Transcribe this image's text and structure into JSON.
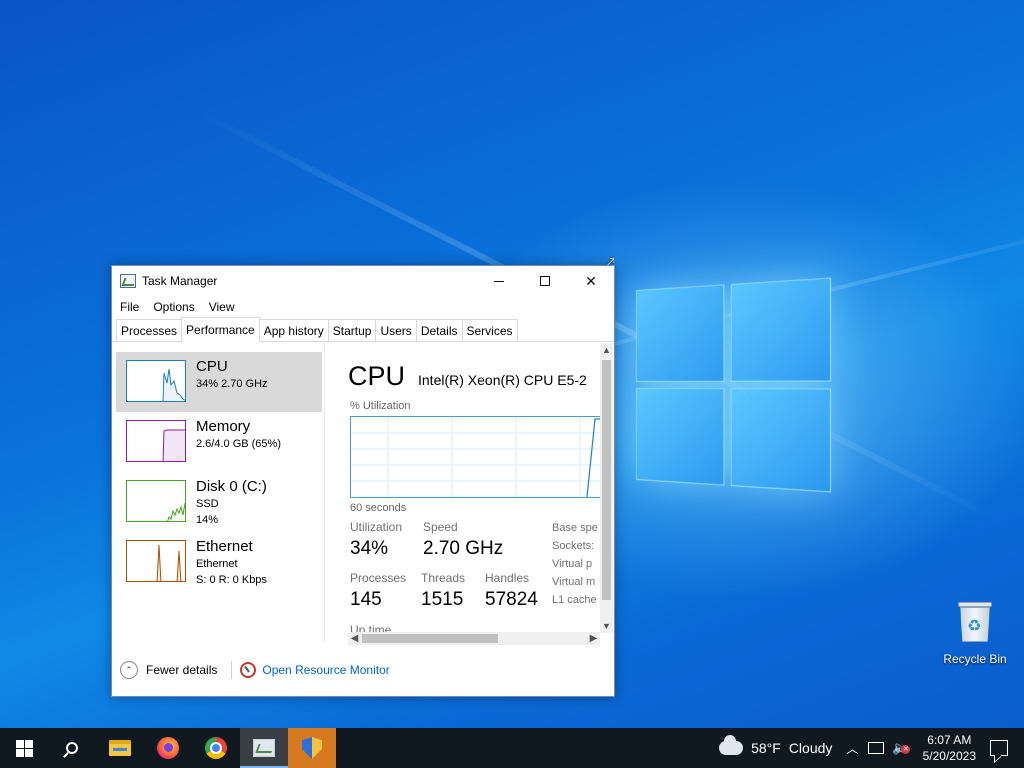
{
  "desktop": {
    "recycle_bin_label": "Recycle Bin"
  },
  "window": {
    "title": "Task Manager",
    "menu": [
      "File",
      "Options",
      "View"
    ],
    "tabs": [
      "Processes",
      "Performance",
      "App history",
      "Startup",
      "Users",
      "Details",
      "Services"
    ],
    "active_tab": "Performance"
  },
  "sidebar": {
    "items": [
      {
        "name": "CPU",
        "line1": "34%  2.70 GHz",
        "line2": "",
        "color": "#1a7fc1"
      },
      {
        "name": "Memory",
        "line1": "2.6/4.0 GB (65%)",
        "line2": "",
        "color": "#8b1ea3"
      },
      {
        "name": "Disk 0 (C:)",
        "line1": "SSD",
        "line2": "14%",
        "color": "#4da127"
      },
      {
        "name": "Ethernet",
        "line1": "Ethernet",
        "line2": "S: 0  R: 0 Kbps",
        "color": "#a74f01"
      }
    ]
  },
  "detail": {
    "heading": "CPU",
    "model": "Intel(R) Xeon(R) CPU E5-2",
    "graph_label": "% Utilization",
    "graph_span": "60 seconds",
    "stats": {
      "utilization": {
        "label": "Utilization",
        "value": "34%"
      },
      "speed": {
        "label": "Speed",
        "value": "2.70 GHz"
      },
      "processes": {
        "label": "Processes",
        "value": "145"
      },
      "threads": {
        "label": "Threads",
        "value": "1515"
      },
      "handles": {
        "label": "Handles",
        "value": "57824"
      },
      "uptime": {
        "label": "Up time"
      }
    },
    "side_labels": [
      "Base spe",
      "Sockets:",
      "Virtual p",
      "Virtual m",
      "L1 cache"
    ]
  },
  "footer": {
    "fewer_details": "Fewer details",
    "open_resource_monitor": "Open Resource Monitor"
  },
  "taskbar": {
    "weather_temp": "58°F",
    "weather_condition": "Cloudy",
    "time": "6:07 AM",
    "date": "5/20/2023"
  }
}
